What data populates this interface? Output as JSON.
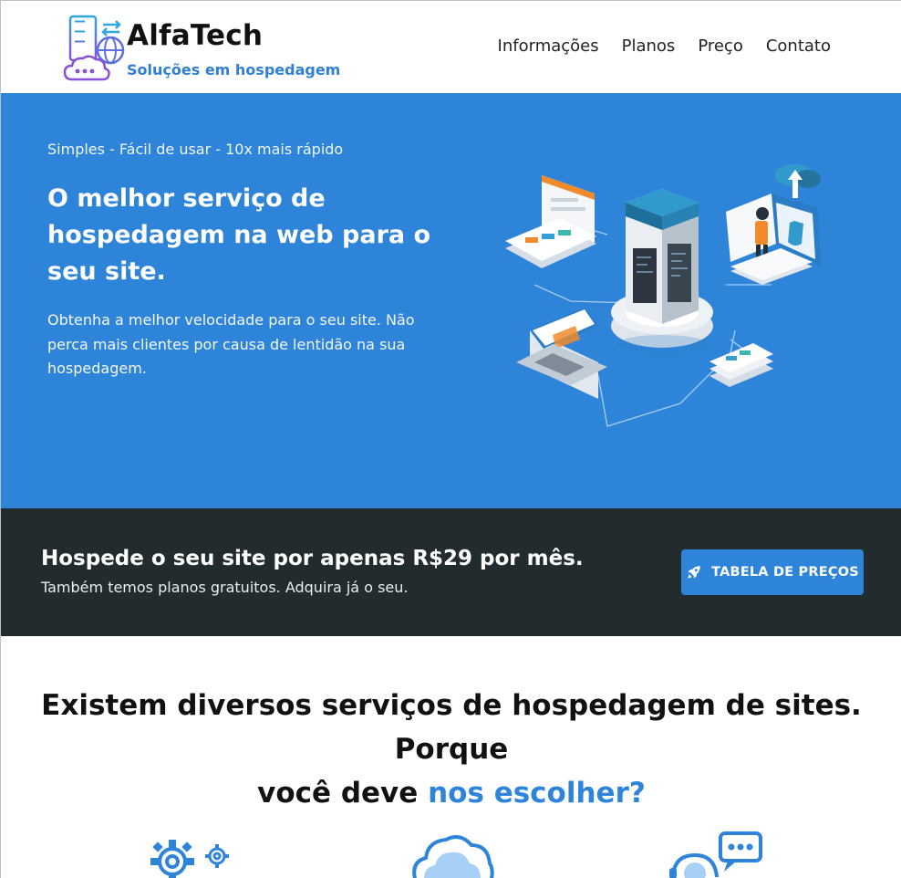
{
  "header": {
    "logo_title": "AlfaTech",
    "logo_subtitle": "Soluções em hospedagem",
    "nav": [
      "Informações",
      "Planos",
      "Preço",
      "Contato"
    ]
  },
  "hero": {
    "tagline": "Simples - Fácil de usar - 10x mais rápido",
    "title": "O melhor serviço de hospedagem na web para o seu site.",
    "text": "Obtenha a melhor velocidade para o seu site. Não perca mais clientes por causa de lentidão na sua hospedagem."
  },
  "cta": {
    "title": "Hospede o seu site por apenas R$29 por mês.",
    "subtitle": "Também temos planos gratuitos. Adquira já o seu.",
    "button_label": "TABELA DE PREÇOS",
    "button_icon": "rocket-icon"
  },
  "why": {
    "title_line1": "Existem diversos serviços de hospedagem de sites. Porque",
    "title_line2_plain": "você deve",
    "title_line2_accent": "nos escolher?",
    "features": [
      {
        "icon": "gears-icon"
      },
      {
        "icon": "cloud-icon"
      },
      {
        "icon": "support-chat-icon"
      }
    ]
  },
  "colors": {
    "brand_blue": "#2e84d9",
    "dark_band": "#222c2f"
  }
}
